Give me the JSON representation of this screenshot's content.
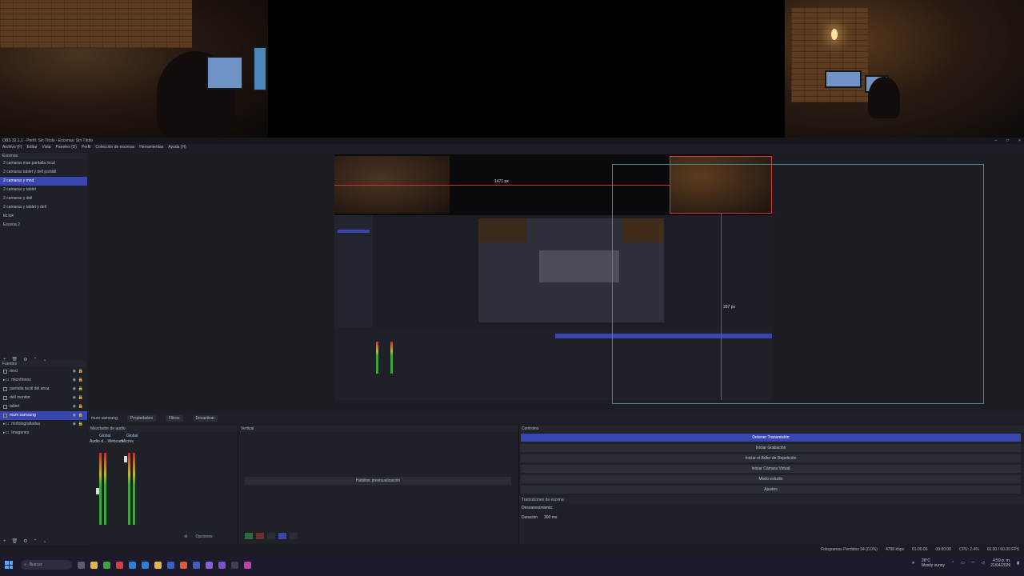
{
  "window": {
    "title": "OBS 32.1.1 - Perfil: Sin Título - Escenas: Sin Título"
  },
  "menu": [
    "Archivo (F)",
    "Editar",
    "Vista",
    "Paneles (D)",
    "Perfil",
    "Colección de escenas",
    "Herramientas",
    "Ayuda (H)"
  ],
  "scenes": {
    "title": "Escenas",
    "items": [
      {
        "label": "2 camaras mas pantalla local",
        "selected": false
      },
      {
        "label": "2 camaras tablet y dell portátil",
        "selected": false
      },
      {
        "label": "2 camaras y mnd",
        "selected": true
      },
      {
        "label": "2 camaras y tablet",
        "selected": false
      },
      {
        "label": "2 camaras y dell",
        "selected": false
      },
      {
        "label": "2 camaras y tablet y dell",
        "selected": false
      },
      {
        "label": "tik tok",
        "selected": false
      },
      {
        "label": "Escena 2",
        "selected": false
      }
    ]
  },
  "sources": {
    "title": "Fuentes",
    "items": [
      {
        "label": "mnd",
        "selected": false
      },
      {
        "label": "micrófonos",
        "selected": false
      },
      {
        "label": "pantalla tacitl del anva",
        "selected": false
      },
      {
        "label": "dell monitor",
        "selected": false
      },
      {
        "label": "tablet",
        "selected": false
      },
      {
        "label": "mum samsung",
        "selected": true
      },
      {
        "label": "mnfotografiadas",
        "selected": false
      },
      {
        "label": "Imagenes",
        "selected": false
      }
    ]
  },
  "preview": {
    "measure_h": "1471 px",
    "measure_v": "337 px"
  },
  "context_bar": {
    "source": "mum samsung",
    "properties": "Propiedades",
    "filters": "Filtros",
    "deactivate": "Desactivar"
  },
  "mixer": {
    "title": "Mezclador de audio",
    "ch1": "Global",
    "ch2": "Global",
    "ch1_sub": "Audio d... Webcam",
    "ch2_sub": "Micros",
    "bottom": "Opciones"
  },
  "vertical": {
    "title": "Vertical",
    "button": "Habilitar previsualización"
  },
  "controls": {
    "title": "Controles",
    "buttons": [
      {
        "label": "Detener Transmisión",
        "active": true
      },
      {
        "label": "Iniciar Grabación",
        "active": false
      },
      {
        "label": "Iniciar el Búfer de Repetición",
        "active": false
      },
      {
        "label": "Iniciar Cámara Virtual",
        "active": false
      },
      {
        "label": "Modo estudio",
        "active": false
      },
      {
        "label": "Ajustes",
        "active": false
      }
    ],
    "transitions_title": "Transiciones de escena",
    "transition_value": "Desvanecimiento",
    "duration_label": "Duración",
    "duration_value": "300 ms"
  },
  "status": {
    "dropped": "Fotogramas Perdidos 34 (0.0%)",
    "bitrate": "4798 kbps",
    "live": "01:00:06",
    "rec": "00:00:00",
    "cpu": "CPU: 2.4%",
    "fps": "60.00 / 60.00 FPS"
  },
  "taskbar": {
    "search": "Buscar",
    "weather_temp": "28°C",
    "weather_desc": "Mostly sunny",
    "time": "4:59 p. m.",
    "date": "21/04/2026"
  },
  "colors": {
    "accent": "#3a46b0",
    "selection_red": "#d43a3a",
    "guide_cyan": "#3f8a96"
  }
}
